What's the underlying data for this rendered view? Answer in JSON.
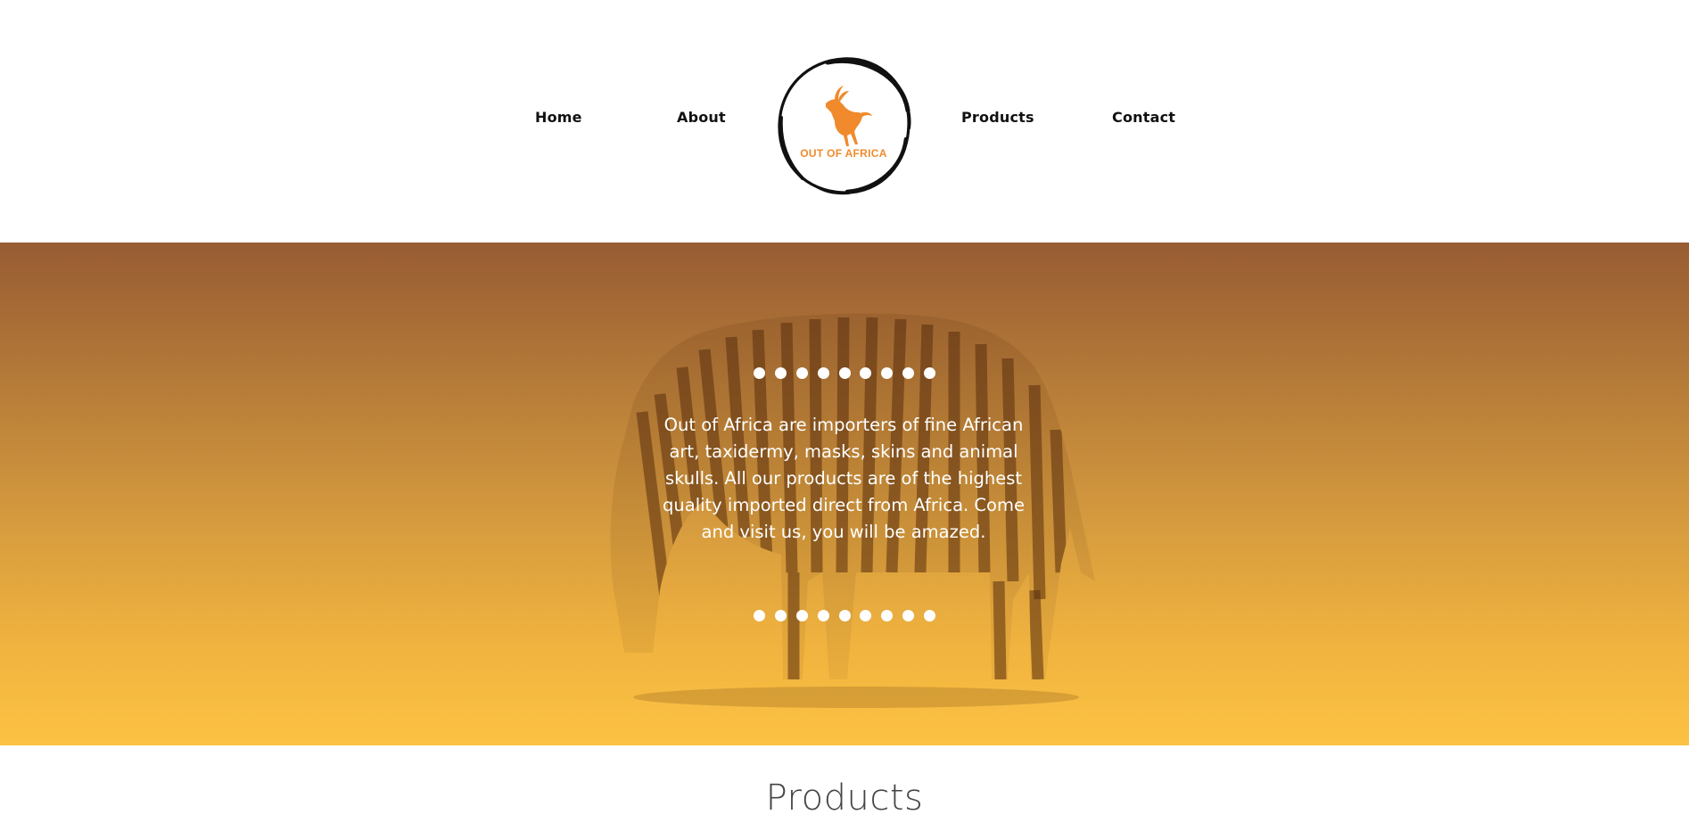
{
  "nav": {
    "home": "Home",
    "about": "About",
    "products": "Products",
    "contact": "Contact"
  },
  "logo": {
    "text": "OUT OF AFRICA",
    "icon": "antelope-icon",
    "color": "#f08a2c"
  },
  "hero": {
    "text": "Out of Africa are importers of fine African art, taxidermy, masks, skins and animal skulls. All our products are of the highest quality imported direct from Africa. Come and visit us, you will be amazed.",
    "image": "zebra-image",
    "gradient_top": "#985c33",
    "gradient_bottom": "#fcc243"
  },
  "products_section": {
    "heading": "Products"
  }
}
